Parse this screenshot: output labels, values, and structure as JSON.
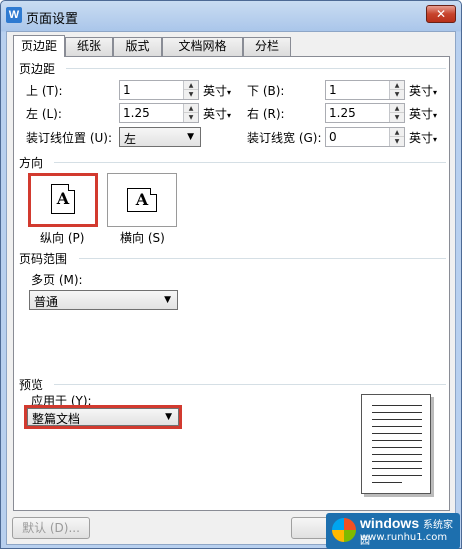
{
  "window": {
    "title": "页面设置",
    "app_icon_letter": "W",
    "close_glyph": "✕"
  },
  "tabs": [
    "页边距",
    "纸张",
    "版式",
    "文档网格",
    "分栏"
  ],
  "margins": {
    "section_label": "页边距",
    "top": {
      "label": "上 (T):",
      "value": "1",
      "unit": "英寸"
    },
    "bottom": {
      "label": "下 (B):",
      "value": "1",
      "unit": "英寸"
    },
    "left": {
      "label": "左 (L):",
      "value": "1.25",
      "unit": "英寸"
    },
    "right": {
      "label": "右 (R):",
      "value": "1.25",
      "unit": "英寸"
    },
    "gutter_position": {
      "label": "装订线位置 (U):",
      "value": "左"
    },
    "gutter_width": {
      "label": "装订线宽 (G):",
      "value": "0",
      "unit": "英寸"
    }
  },
  "orientation": {
    "section_label": "方向",
    "glyph": "A",
    "portrait": {
      "label": "纵向 (P)",
      "selected": true
    },
    "landscape": {
      "label": "横向 (S)",
      "selected": false
    }
  },
  "page_range": {
    "section_label": "页码范围",
    "multiple_pages_label": "多页 (M):",
    "multiple_pages_value": "普通"
  },
  "preview": {
    "section_label": "预览",
    "apply_to_label": "应用于 (Y):",
    "apply_to_value": "整篇文档"
  },
  "buttons": {
    "default_label": "默认 (D)..."
  },
  "watermark": {
    "brand": "windows",
    "site": "系统家园",
    "url": "www.runhu1.com"
  },
  "colors": {
    "highlight": "#d23a2f",
    "title_bar": "#aac6ea"
  }
}
